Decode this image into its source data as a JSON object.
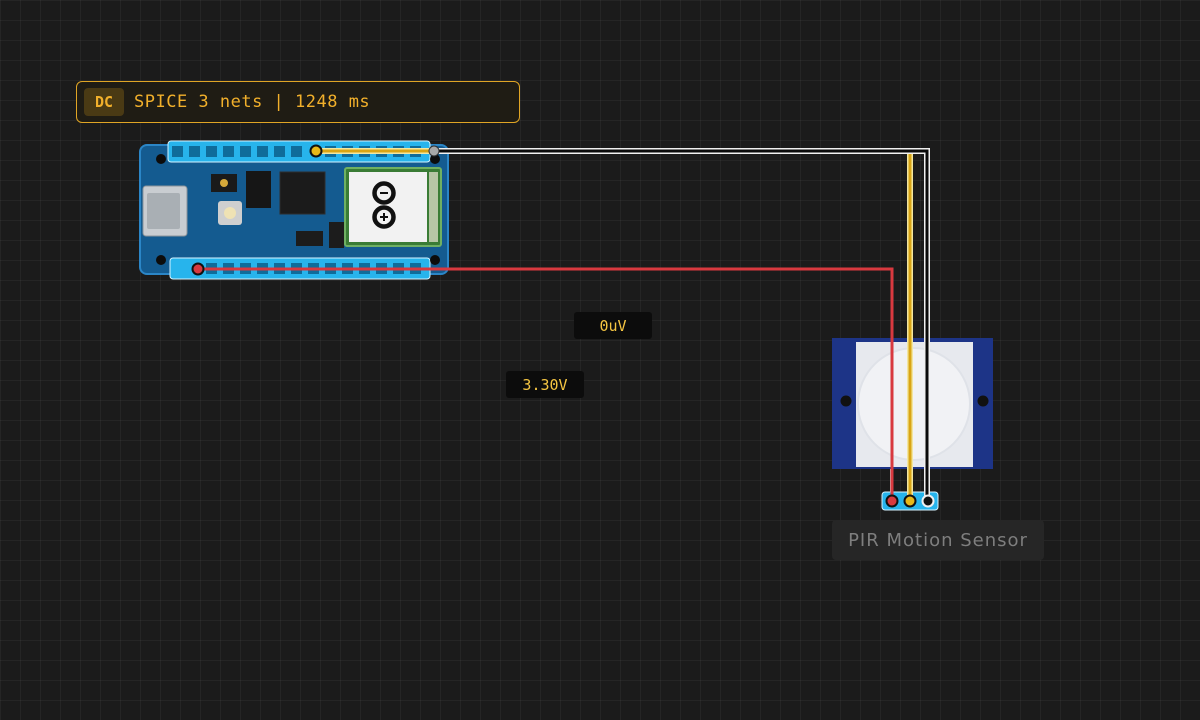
{
  "status": {
    "mode": "DC",
    "text": "SPICE 3 nets | 1248 ms"
  },
  "probes": {
    "net_a": "0uV",
    "net_b": "3.30V"
  },
  "components": {
    "pir_label": "PIR Motion Sensor"
  },
  "colors": {
    "signal_wire": "#d9a514",
    "power_wire": "#d8393f",
    "ground_wire": "#0a0a0a",
    "accent": "#e0a525",
    "pin_highlight": "#27b4ec",
    "board_pcb": "#145b90",
    "sensor_pcb": "#1d3487"
  },
  "icons": {
    "board_logo": "arduino-infinity-icon"
  }
}
